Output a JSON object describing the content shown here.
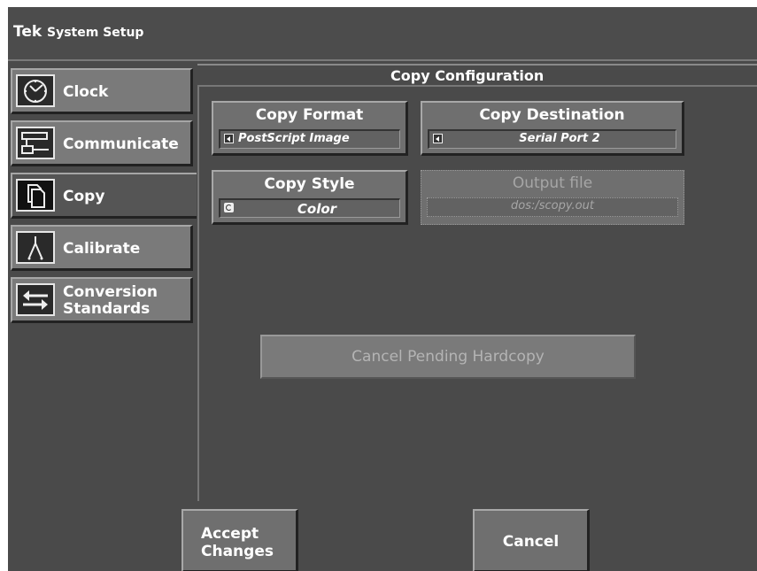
{
  "title": {
    "brand": "Tek",
    "text": "System Setup"
  },
  "sidebar": {
    "items": [
      {
        "label": "Clock",
        "icon": "clock-icon"
      },
      {
        "label": "Communicate",
        "icon": "network-icon"
      },
      {
        "label": "Copy",
        "icon": "copy-icon",
        "selected": true
      },
      {
        "label": "Calibrate",
        "icon": "probe-icon"
      },
      {
        "label": "Conversion Standards",
        "icon": "arrows-icon"
      }
    ]
  },
  "section": {
    "title": "Copy Configuration"
  },
  "controls": {
    "copy_format": {
      "label": "Copy Format",
      "value": "PostScript Image"
    },
    "copy_destination": {
      "label": "Copy Destination",
      "value": "Serial Port 2"
    },
    "copy_style": {
      "label": "Copy Style",
      "value": "Color"
    },
    "output_file": {
      "label": "Output file",
      "value": "dos:/scopy.out",
      "enabled": false
    }
  },
  "cancel_pending": {
    "label": "Cancel Pending Hardcopy",
    "enabled": false
  },
  "footer": {
    "accept_label": "Accept Changes",
    "cancel_label": "Cancel"
  }
}
